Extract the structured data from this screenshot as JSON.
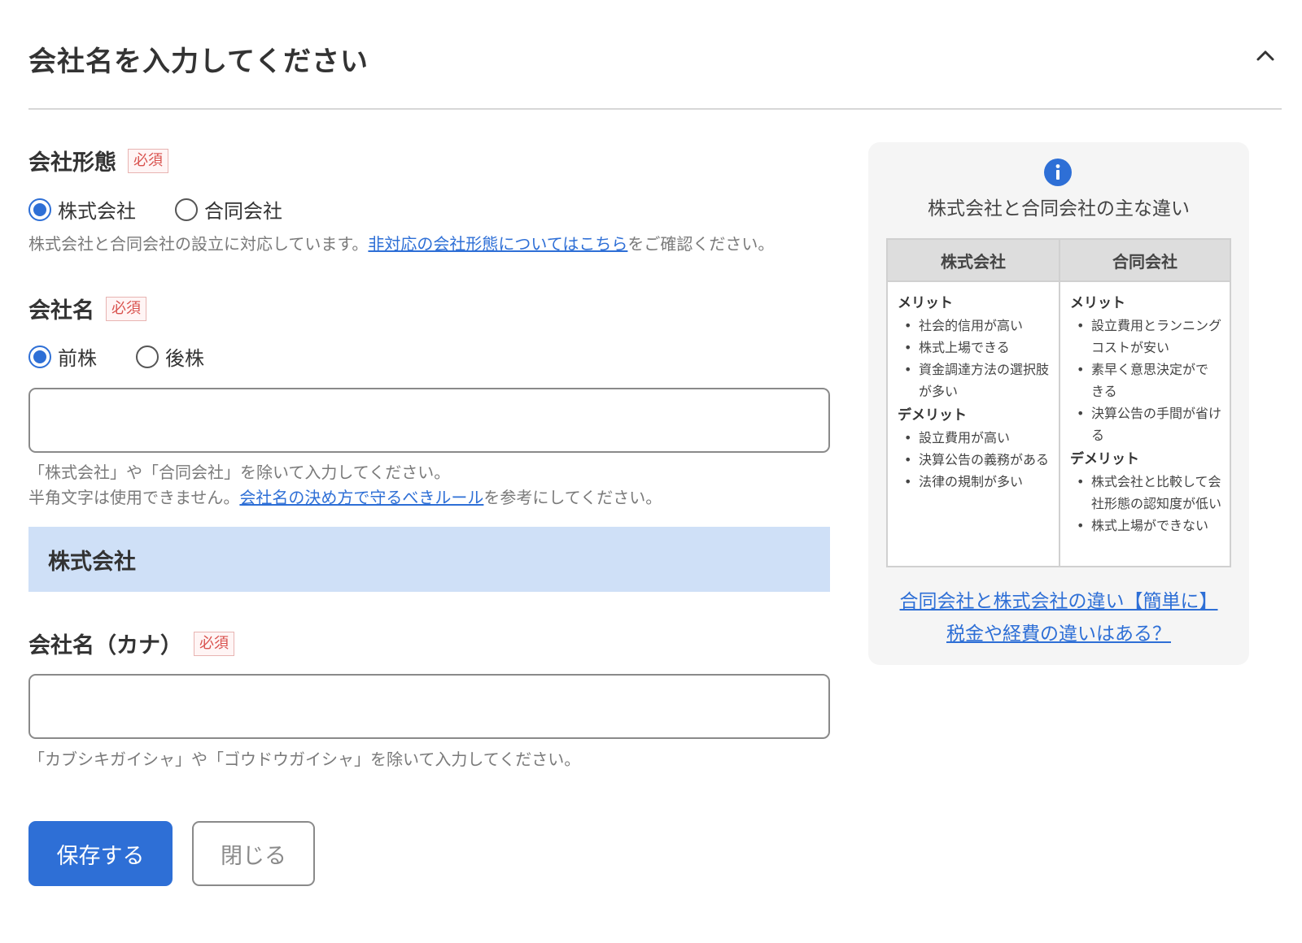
{
  "header": {
    "title": "会社名を入力してください"
  },
  "company_type": {
    "label": "会社形態",
    "required": "必須",
    "options": [
      {
        "label": "株式会社",
        "checked": true
      },
      {
        "label": "合同会社",
        "checked": false
      }
    ],
    "help_prefix": "株式会社と合同会社の設立に対応しています。",
    "help_link": "非対応の会社形態についてはこちら",
    "help_suffix": "をご確認ください。"
  },
  "company_name": {
    "label": "会社名",
    "required": "必須",
    "options": [
      {
        "label": "前株",
        "checked": true
      },
      {
        "label": "後株",
        "checked": false
      }
    ],
    "value": "",
    "help_line1": "「株式会社」や「合同会社」を除いて入力してください。",
    "help_line2_prefix": "半角文字は使用できません。",
    "help_line2_link": "会社名の決め方で守るべきルール",
    "help_line2_suffix": "を参考にしてください。",
    "preview": "株式会社"
  },
  "company_kana": {
    "label": "会社名（カナ）",
    "required": "必須",
    "value": "",
    "help": "「カブシキガイシャ」や「ゴウドウガイシャ」を除いて入力してください。"
  },
  "buttons": {
    "save": "保存する",
    "close": "閉じる"
  },
  "side_panel": {
    "title": "株式会社と合同会社の主な違い",
    "columns": [
      {
        "heading": "株式会社",
        "merit_label": "メリット",
        "merits": [
          "社会的信用が高い",
          "株式上場できる",
          "資金調達方法の選択肢が多い"
        ],
        "demerit_label": "デメリット",
        "demerits": [
          "設立費用が高い",
          "決算公告の義務がある",
          "法律の規制が多い"
        ]
      },
      {
        "heading": "合同会社",
        "merit_label": "メリット",
        "merits": [
          "設立費用とランニングコストが安い",
          "素早く意思決定ができる",
          "決算公告の手間が省ける"
        ],
        "demerit_label": "デメリット",
        "demerits": [
          "株式会社と比較して会社形態の認知度が低い",
          "株式上場ができない"
        ]
      }
    ],
    "link_line1": "合同会社と株式会社の違い【簡単に】",
    "link_line2": "税金や経費の違いはある？"
  },
  "colors": {
    "accent": "#2e6fd6",
    "required": "#d9534f",
    "preview_bg": "#cfe0f7",
    "panel_bg": "#f5f5f5"
  },
  "icons": {
    "collapse": "chevron-up-icon",
    "info": "info-icon"
  }
}
